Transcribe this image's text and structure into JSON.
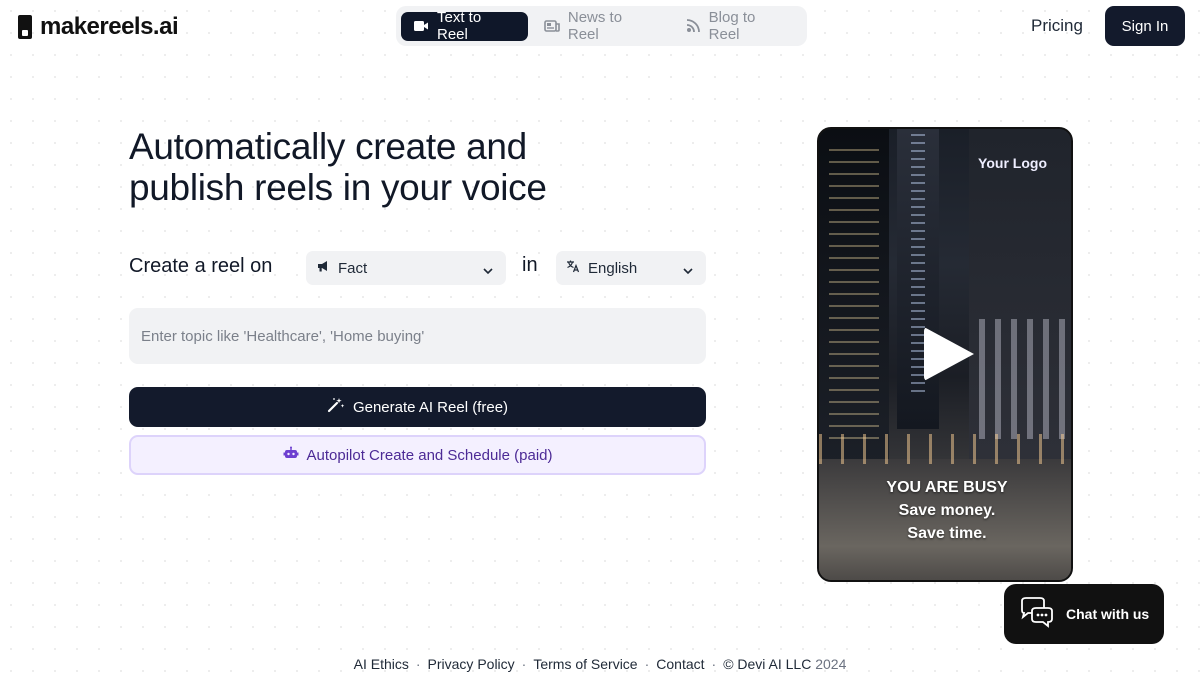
{
  "header": {
    "logo_text": "makereels.ai",
    "tabs": [
      {
        "label": "Text to Reel",
        "icon": "video-icon",
        "active": true
      },
      {
        "label": "News to Reel",
        "icon": "news-icon",
        "active": false
      },
      {
        "label": "Blog to Reel",
        "icon": "rss-icon",
        "active": false
      }
    ],
    "pricing_label": "Pricing",
    "signin_label": "Sign In"
  },
  "hero": {
    "headline_line1": "Automatically create and",
    "headline_line2": "publish reels in your voice",
    "create_label": "Create a reel on",
    "type_select": {
      "value": "Fact",
      "icon": "megaphone-icon"
    },
    "in_label": "in",
    "language_select": {
      "value": "English",
      "icon": "translate-icon"
    },
    "topic_placeholder": "Enter topic like 'Healthcare', 'Home buying'",
    "generate_label": "Generate AI Reel (free)",
    "autopilot_label": "Autopilot Create and Schedule (paid)"
  },
  "video": {
    "logo_text": "Your Logo",
    "caption_line1": "YOU ARE BUSY",
    "caption_line2": "Save money.",
    "caption_line3": "Save time."
  },
  "chat": {
    "label": "Chat with us"
  },
  "footer": {
    "links": [
      "AI Ethics",
      "Privacy Policy",
      "Terms of Service",
      "Contact"
    ],
    "copyright": "© Devi AI LLC",
    "year": "2024"
  },
  "colors": {
    "primary_dark": "#131a2c",
    "tab_bg": "#f1f2f4",
    "autopilot_bg": "#f4f0ff",
    "autopilot_border": "#ddd3fb",
    "autopilot_text": "#4c2a96"
  }
}
